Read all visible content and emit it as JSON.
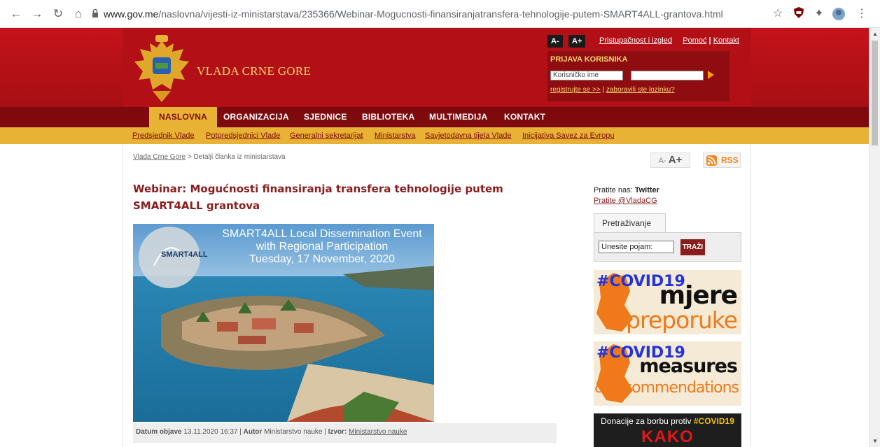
{
  "browser": {
    "url_host": "www.gov.me",
    "url_path": "/naslovna/vijesti-iz-ministarstava/235366/Webinar-Mogucnosti-finansiranjatransfera-tehnologije-putem-SMART4ALL-grantova.html"
  },
  "header": {
    "site_title": "VLADA CRNE GORE",
    "font_smaller": "A-",
    "font_larger": "A+",
    "link_accessibility": "Pristupačnost i izgled",
    "link_help": "Pomoć",
    "link_sep": " | ",
    "link_contact": "Kontakt"
  },
  "login": {
    "title": "PRIJAVA KORISNIKA",
    "username_placeholder": "Korisničko ime",
    "register_link": "registrujte se >>",
    "sep": " | ",
    "forgot_link": "zaboravili ste lozinku?"
  },
  "nav": {
    "items": [
      "NASLOVNA",
      "ORGANIZACIJA",
      "SJEDNICE",
      "BIBLIOTEKA",
      "MULTIMEDIJA",
      "KONTAKT"
    ],
    "active": "NASLOVNA"
  },
  "subnav": {
    "items": [
      "Predsjednik Vlade",
      "Potpredsjednici Vlade",
      "Generalni sekretarijat",
      "Ministarstva",
      "Savjetodavna tijela Vlade",
      "Inicijativa Savez za Evropu"
    ]
  },
  "breadcrumb": {
    "home": "Vlada Crne Gore",
    "sep": " > ",
    "current": "Detalji članka iz ministarstava"
  },
  "tools": {
    "size_small": "A-",
    "size_large": "A+",
    "rss": "RSS"
  },
  "article": {
    "title": "Webinar: Mogućnosti finansiranja transfera tehnologije putem SMART4ALL grantova",
    "image_line1": "SMART4ALL Local Dissemination Event",
    "image_line2": "with Regional Participation",
    "image_line3": "Tuesday, 17 November, 2020",
    "image_logo": "SMART4ALL",
    "meta_date_label": "Datum objave",
    "meta_date": "13.11.2020 16:37",
    "meta_author_label": "Autor",
    "meta_author": "Ministarstvo nauke",
    "meta_source_label": "Izvor:",
    "meta_source": "Ministarstvo nauke"
  },
  "sidebar": {
    "follow_text": "Pratite nas:",
    "follow_network": "Twitter",
    "follow_link": "Pratite @VladaCG",
    "search_tab": "Pretraživanje",
    "search_placeholder": "Unesite pojam:",
    "search_button": "TRAŽI",
    "banner1_tag": "#COVID19",
    "banner1_word1": "mjere",
    "banner1_word2": "i preporuke",
    "banner2_tag": "#COVID19",
    "banner2_word1": "measures",
    "banner2_word2": "& recommendations",
    "banner3_line1": "Donacije za borbu protiv",
    "banner3_tag": "#COVID19",
    "banner3_line2": "KAKO DONIRATI?"
  },
  "colors": {
    "header_red": "#b30f16",
    "nav_dark": "#7f0a0e",
    "gold": "#e8b335",
    "title_red": "#8c1d1d",
    "covid_blue": "#2233dd",
    "covid_orange": "#f07a1a"
  }
}
